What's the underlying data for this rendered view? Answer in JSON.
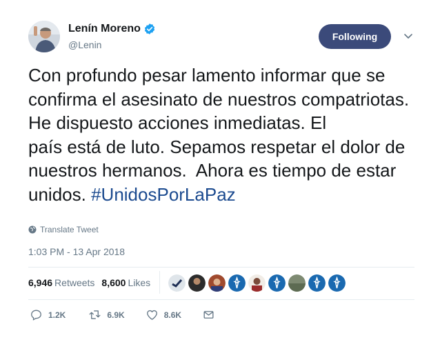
{
  "author": {
    "display_name": "Lenín Moreno",
    "handle": "@Lenin",
    "verified_icon": "verified-badge-icon"
  },
  "follow_button": {
    "label": "Following"
  },
  "tweet": {
    "text": "Con profundo pesar lamento informar que se confirma el asesinato de nuestros compatriotas. He dispuesto acciones inmediatas. El\npaís está de luto. Sepamos respetar el dolor de nuestros hermanos.  Ahora es tiempo de estar unidos. ",
    "hashtag": "#UnidosPorLaPaz"
  },
  "translate_label": "Translate Tweet",
  "timestamp": "1:03 PM - 13 Apr 2018",
  "stats": {
    "retweets_count": "6,946",
    "retweets_label": "Retweets",
    "likes_count": "8,600",
    "likes_label": "Likes"
  },
  "actions": {
    "replies": "1.2K",
    "retweets": "6.9K",
    "likes": "8.6K"
  },
  "colors": {
    "follow_bg": "#3b4a7a",
    "hashtag": "#1b4a8f",
    "muted": "#657786",
    "verified": "#1da1f2"
  }
}
